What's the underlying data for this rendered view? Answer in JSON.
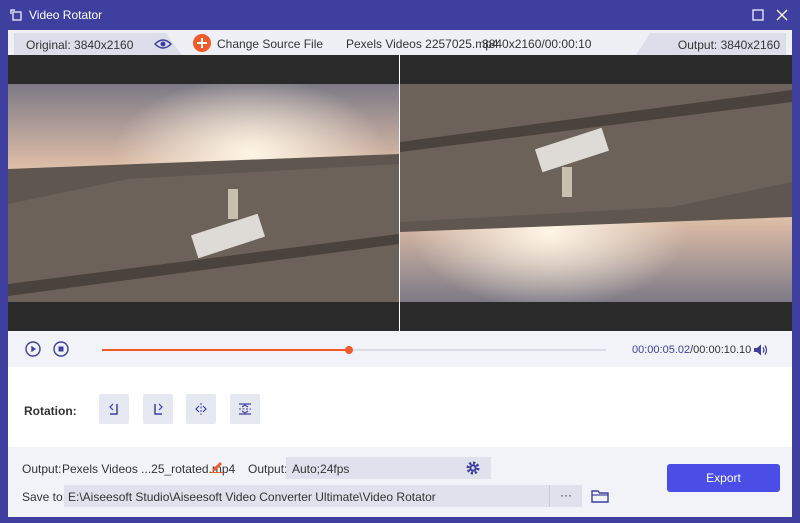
{
  "window": {
    "title": "Video Rotator",
    "icons": {
      "app": "rotate-window-icon",
      "maximize": "maximize-icon",
      "close": "close-icon"
    }
  },
  "infobar": {
    "original_label": "Original: 3840x2160",
    "change_source_label": "Change Source File",
    "file_name": "Pexels Videos 2257025.mp4",
    "file_meta": "3840x2160/00:00:10",
    "output_label": "Output: 3840x2160",
    "icons": {
      "preview": "eye-icon",
      "add": "plus-icon"
    }
  },
  "player": {
    "current_time": "00:00:05.02",
    "total_time": "/00:00:10.10",
    "progress_fraction": 0.49,
    "icons": {
      "play": "play-icon",
      "stop": "stop-icon",
      "volume": "volume-icon"
    }
  },
  "rotation": {
    "label": "Rotation:",
    "buttons": [
      "rotate-left-icon",
      "rotate-right-icon",
      "flip-horizontal-icon",
      "flip-vertical-icon"
    ]
  },
  "output": {
    "label": "Output:",
    "file_name": "Pexels Videos ...25_rotated.mp4",
    "format_label": "Output:",
    "format_value": "Auto;24fps",
    "save_label": "Save to:",
    "save_path": "E:\\Aiseesoft Studio\\Aiseesoft Video Converter Ultimate\\Video Rotator",
    "browse_label": "···",
    "export_label": "Export",
    "icons": {
      "edit": "pencil-icon",
      "settings": "gear-icon",
      "folder": "folder-icon"
    }
  },
  "colors": {
    "titlebar": "#3f3fa0",
    "accent": "#f15a2a",
    "export": "#4b4ee6",
    "time": "#3f3fa0"
  }
}
